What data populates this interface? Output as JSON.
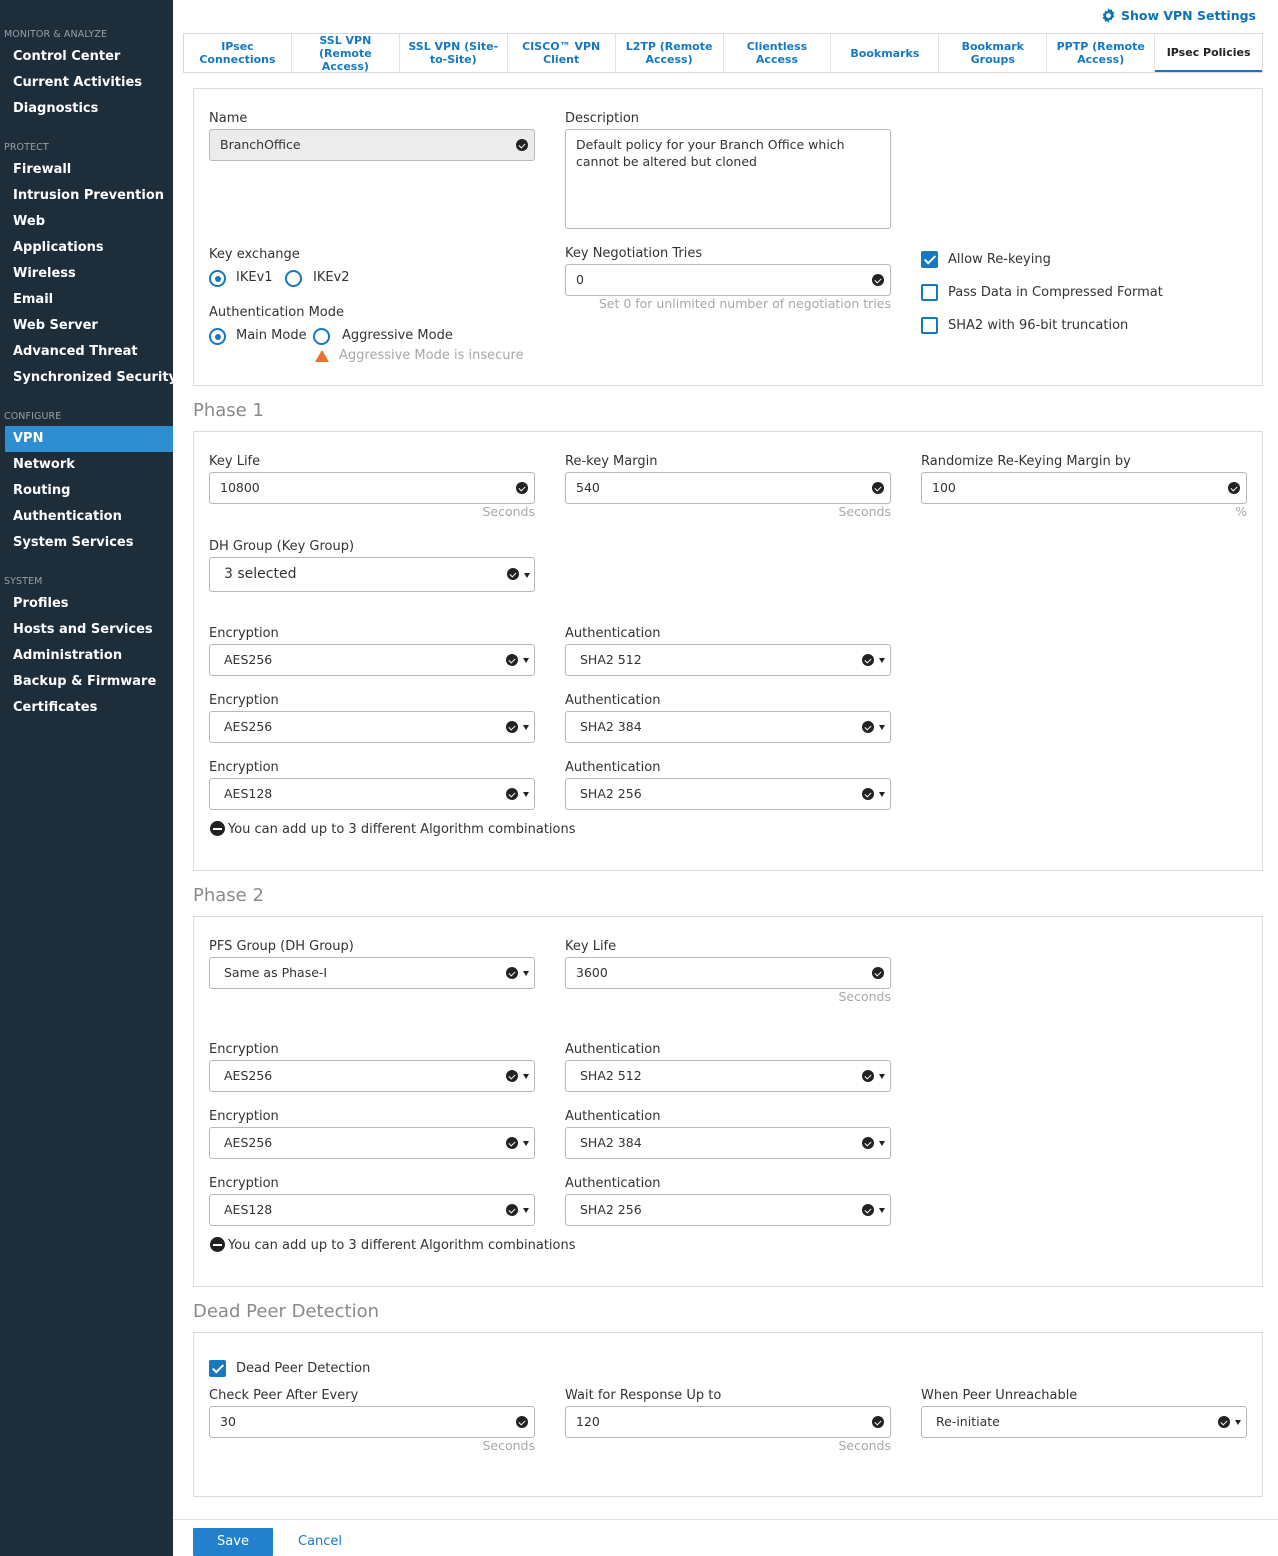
{
  "sidebar": {
    "groups": [
      {
        "title": "MONITOR & ANALYZE",
        "items": [
          "Control Center",
          "Current Activities",
          "Diagnostics"
        ]
      },
      {
        "title": "PROTECT",
        "items": [
          "Firewall",
          "Intrusion Prevention",
          "Web",
          "Applications",
          "Wireless",
          "Email",
          "Web Server",
          "Advanced Threat",
          "Synchronized Security"
        ]
      },
      {
        "title": "CONFIGURE",
        "items": [
          "VPN",
          "Network",
          "Routing",
          "Authentication",
          "System Services"
        ]
      },
      {
        "title": "SYSTEM",
        "items": [
          "Profiles",
          "Hosts and Services",
          "Administration",
          "Backup & Firmware",
          "Certificates"
        ]
      }
    ],
    "active": "VPN"
  },
  "top": {
    "show_vpn_settings": "Show VPN Settings"
  },
  "tabs": [
    "IPsec Connections",
    "SSL VPN (Remote Access)",
    "SSL VPN (Site-to-Site)",
    "CISCO™ VPN Client",
    "L2TP (Remote Access)",
    "Clientless Access",
    "Bookmarks",
    "Bookmark Groups",
    "PPTP (Remote Access)",
    "IPsec Policies"
  ],
  "general": {
    "name_label": "Name",
    "name_value": "BranchOffice",
    "description_label": "Description",
    "description_value": "Default policy for your Branch Office which cannot be altered but cloned",
    "key_exchange_label": "Key exchange",
    "ikev1": "IKEv1",
    "ikev2": "IKEv2",
    "key_exchange_selected": "IKEv1",
    "auth_mode_label": "Authentication Mode",
    "main_mode": "Main Mode",
    "aggressive_mode": "Aggressive Mode",
    "auth_mode_selected": "Main Mode",
    "aggressive_warning": "Aggressive Mode is insecure",
    "key_neg_tries_label": "Key Negotiation Tries",
    "key_neg_tries_value": "0",
    "key_neg_tries_hint": "Set 0 for unlimited number of negotiation tries",
    "allow_rekeying": "Allow Re-keying",
    "allow_rekeying_checked": true,
    "pass_compressed": "Pass Data in Compressed Format",
    "pass_compressed_checked": false,
    "sha2_96": "SHA2 with 96-bit truncation",
    "sha2_96_checked": false
  },
  "phase1": {
    "title": "Phase 1",
    "key_life_label": "Key Life",
    "key_life_value": "10800",
    "key_life_unit": "Seconds",
    "rekey_margin_label": "Re-key Margin",
    "rekey_margin_value": "540",
    "rekey_margin_unit": "Seconds",
    "randomize_label": "Randomize Re-Keying Margin by",
    "randomize_value": "100",
    "randomize_unit": "%",
    "dh_group_label": "DH Group (Key Group)",
    "dh_group_value": "3 selected",
    "enc_label": "Encryption",
    "auth_label": "Authentication",
    "combos": [
      {
        "enc": "AES256",
        "auth": "SHA2 512"
      },
      {
        "enc": "AES256",
        "auth": "SHA2 384"
      },
      {
        "enc": "AES128",
        "auth": "SHA2 256"
      }
    ],
    "combo_note": "You can add up to 3 different Algorithm combinations"
  },
  "phase2": {
    "title": "Phase 2",
    "pfs_label": "PFS Group (DH Group)",
    "pfs_value": "Same as Phase-I",
    "key_life_label": "Key Life",
    "key_life_value": "3600",
    "key_life_unit": "Seconds",
    "enc_label": "Encryption",
    "auth_label": "Authentication",
    "combos": [
      {
        "enc": "AES256",
        "auth": "SHA2 512"
      },
      {
        "enc": "AES256",
        "auth": "SHA2 384"
      },
      {
        "enc": "AES128",
        "auth": "SHA2 256"
      }
    ],
    "combo_note": "You can add up to 3 different Algorithm combinations"
  },
  "dpd": {
    "title": "Dead Peer Detection",
    "enabled_label": "Dead Peer Detection",
    "enabled": true,
    "check_label": "Check Peer After Every",
    "check_value": "30",
    "check_unit": "Seconds",
    "wait_label": "Wait for Response Up to",
    "wait_value": "120",
    "wait_unit": "Seconds",
    "unreachable_label": "When Peer Unreachable",
    "unreachable_value": "Re-initiate"
  },
  "footer": {
    "save": "Save",
    "cancel": "Cancel"
  },
  "colors": {
    "sidebar_bg": "#1d2d3a",
    "accent": "#1778c2",
    "active_nav": "#2d8fd0",
    "warning": "#e9742b"
  }
}
